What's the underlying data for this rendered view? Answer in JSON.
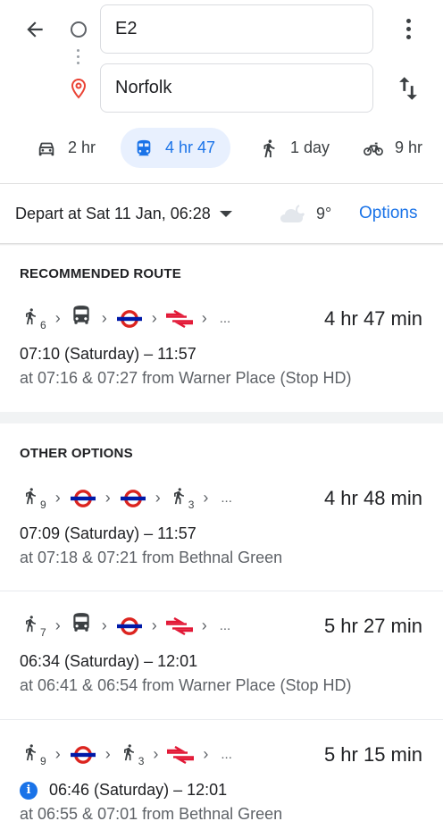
{
  "search": {
    "from_value": "E2",
    "to_value": "Norfolk"
  },
  "modes": [
    {
      "icon": "car-icon",
      "label": "2 hr",
      "selected": false
    },
    {
      "icon": "train-icon",
      "label": "4 hr 47",
      "selected": true
    },
    {
      "icon": "walk-icon",
      "label": "1 day",
      "selected": false
    },
    {
      "icon": "bike-icon",
      "label": "9 hr",
      "selected": false
    }
  ],
  "depart": {
    "label": "Depart at Sat 11 Jan, 06:28",
    "weather": "9°",
    "options_label": "Options"
  },
  "colors": {
    "accent": "#1a73e8",
    "tube_red": "#dc241f",
    "tube_blue": "#0019a8",
    "rail_red": "#e21836"
  },
  "sections": {
    "recommended_title": "RECOMMENDED ROUTE",
    "other_title": "OTHER OPTIONS"
  },
  "routes": [
    {
      "steps": [
        {
          "type": "walk",
          "sub": "6"
        },
        {
          "type": "bus"
        },
        {
          "type": "tube"
        },
        {
          "type": "rail"
        }
      ],
      "ellipsis": "...",
      "duration": "4 hr 47 min",
      "times": "07:10 (Saturday) – 11:57",
      "from": "at 07:16 & 07:27 from Warner Place (Stop HD)",
      "info": false
    },
    {
      "steps": [
        {
          "type": "walk",
          "sub": "9"
        },
        {
          "type": "tube"
        },
        {
          "type": "tube"
        },
        {
          "type": "walk",
          "sub": "3"
        }
      ],
      "ellipsis": "...",
      "duration": "4 hr 48 min",
      "times": "07:09 (Saturday) – 11:57",
      "from": "at 07:18 & 07:21 from Bethnal Green",
      "info": false
    },
    {
      "steps": [
        {
          "type": "walk",
          "sub": "7"
        },
        {
          "type": "bus"
        },
        {
          "type": "tube"
        },
        {
          "type": "rail"
        }
      ],
      "ellipsis": "...",
      "duration": "5 hr 27 min",
      "times": "06:34 (Saturday) – 12:01",
      "from": "at 06:41 & 06:54 from Warner Place (Stop HD)",
      "info": false
    },
    {
      "steps": [
        {
          "type": "walk",
          "sub": "9"
        },
        {
          "type": "tube"
        },
        {
          "type": "walk",
          "sub": "3"
        },
        {
          "type": "rail"
        }
      ],
      "ellipsis": "...",
      "duration": "5 hr 15 min",
      "times": "06:46 (Saturday) – 12:01",
      "from": "at 06:55 & 07:01 from Bethnal Green",
      "info": true,
      "info_glyph": "i"
    }
  ]
}
